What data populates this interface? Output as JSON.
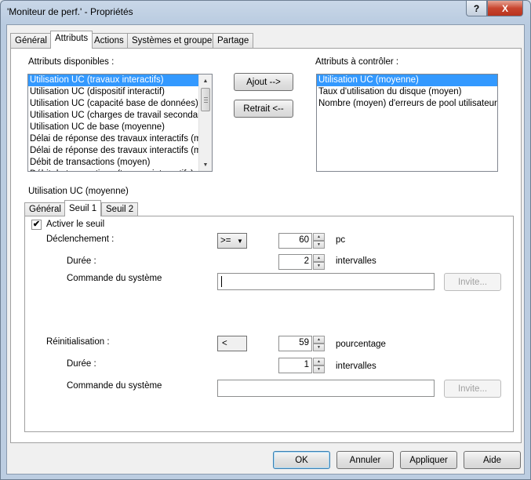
{
  "window": {
    "title": "'Moniteur de perf.' - Propriétés",
    "help_glyph": "?",
    "close_glyph": "X"
  },
  "tabs": [
    "Général",
    "Attributs",
    "Actions",
    "Systèmes et groupes",
    "Partage"
  ],
  "attributes": {
    "available_label": "Attributs disponibles :",
    "available_items": [
      "Utilisation UC (travaux interactifs)",
      "Utilisation UC (dispositif interactif)",
      "Utilisation UC (capacité base de données)",
      "Utilisation UC (charges de travail secondaires)",
      "Utilisation UC de base (moyenne)",
      "Délai de réponse des travaux interactifs (moyen)",
      "Délai de réponse des travaux interactifs (maximum)",
      "Débit de transactions (moyen)",
      "Débit de transactions (travaux interactifs)"
    ],
    "monitored_label": "Attributs à contrôler :",
    "monitored_items": [
      "Utilisation UC (moyenne)",
      "Taux d'utilisation du disque (moyen)",
      "Nombre (moyen) d'erreurs de pool utilisateur"
    ],
    "add_button": "Ajout -->",
    "remove_button": "Retrait <--"
  },
  "selected_attribute": "Utilisation UC (moyenne)",
  "subtabs": [
    "Général",
    "Seuil 1",
    "Seuil 2"
  ],
  "threshold": {
    "enable_label": "Activer le seuil",
    "enabled": true,
    "trigger_label": "Déclenchement :",
    "trigger_operator": ">=",
    "trigger_value": "60",
    "trigger_unit": "pc",
    "trigger_duration_label": "Durée :",
    "trigger_duration_value": "2",
    "trigger_duration_unit": "intervalles",
    "trigger_command_label": "Commande du système",
    "trigger_prompt_button": "Invite...",
    "reset_label": "Réinitialisation :",
    "reset_operator": "<",
    "reset_value": "59",
    "reset_unit": "pourcentage",
    "reset_duration_label": "Durée :",
    "reset_duration_value": "1",
    "reset_duration_unit": "intervalles",
    "reset_command_label": "Commande du système",
    "reset_prompt_button": "Invite..."
  },
  "footer": {
    "ok": "OK",
    "cancel": "Annuler",
    "apply": "Appliquer",
    "help": "Aide"
  },
  "icons": {
    "scroll_up": "▲",
    "scroll_down": "▼",
    "spin_up": "▲",
    "spin_down": "▼",
    "combo_arrow": "▼",
    "check": "✔"
  }
}
